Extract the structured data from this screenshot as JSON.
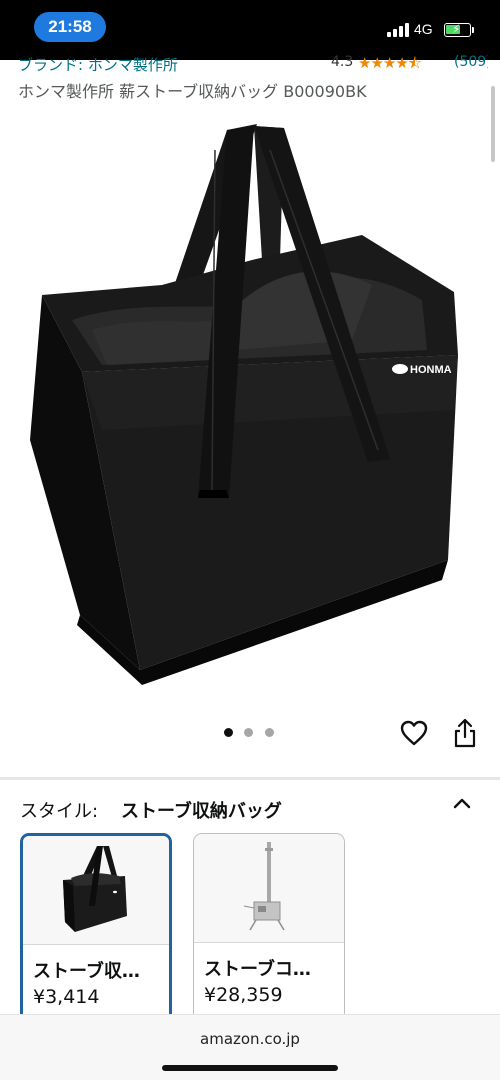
{
  "status_bar": {
    "time": "21:58",
    "network": "4G",
    "battery_color": "#4cd964",
    "icons": [
      "signal-icon",
      "battery-charging-icon"
    ]
  },
  "product": {
    "brand_link": "ブランド: ホンマ製作所",
    "rating": "4.3",
    "stars": 4.3,
    "review_count": "(509)",
    "title": "ホンマ製作所 薪ストーブ収納バッグ B00090BK",
    "image_logo_text": "HONMA"
  },
  "gallery": {
    "image_count": 3,
    "active_index": 0,
    "active_dot_color": "#0f1111",
    "inactive_dot_color": "#a6a6a6",
    "icons": [
      "heart-icon",
      "share-icon"
    ]
  },
  "style_selector": {
    "label": "スタイル:",
    "selected_value": "ストーブ収納バッグ",
    "selected_border_color": "#2162a1",
    "options": [
      {
        "name": "ストーブ収…",
        "price": "¥3,414",
        "selected": true
      },
      {
        "name": "ストーブコ…",
        "price": "¥28,359",
        "selected": false
      }
    ]
  },
  "browser": {
    "domain": "amazon.co.jp"
  }
}
